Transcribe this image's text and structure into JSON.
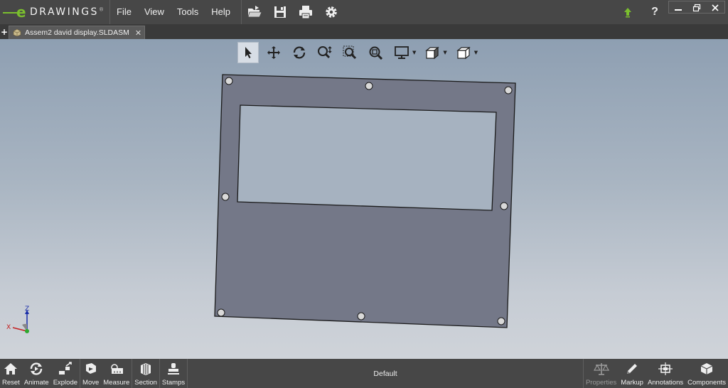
{
  "app": {
    "logo_letter": "e",
    "logo_text": "DRAWINGS",
    "logo_reg": "®"
  },
  "menu": {
    "items": [
      "File",
      "View",
      "Tools",
      "Help"
    ]
  },
  "quick_access": {
    "icons": [
      "open-folder-icon",
      "save-icon",
      "print-icon",
      "gear-icon"
    ]
  },
  "title_right": {
    "update_icon": "green-up-arrow-icon",
    "help_label": "?",
    "window_controls": [
      "minimize",
      "restore",
      "close"
    ]
  },
  "tab": {
    "plus": "+",
    "label": "Assem2 david display.SLDASM",
    "close": "✕"
  },
  "view_toolbar": {
    "tools": [
      "select-arrow-icon",
      "pan-icon",
      "rotate-icon",
      "zoom-in-out-icon",
      "zoom-to-area-icon",
      "zoom-to-fit-icon",
      "display-style-icon",
      "view-orientation-icon",
      "standard-views-icon"
    ]
  },
  "triad": {
    "z": "Z",
    "x": "X"
  },
  "bottom": {
    "left_groups": [
      [
        {
          "label": "Reset",
          "icon": "home-icon"
        },
        {
          "label": "Animate",
          "icon": "animate-icon"
        },
        {
          "label": "Explode",
          "icon": "explode-icon"
        }
      ],
      [
        {
          "label": "Move",
          "icon": "move-icon"
        },
        {
          "label": "Measure",
          "icon": "measure-icon"
        }
      ],
      [
        {
          "label": "Section",
          "icon": "section-icon"
        }
      ],
      [
        {
          "label": "Stamps",
          "icon": "stamp-icon"
        }
      ]
    ],
    "center_label": "Default",
    "right_items": [
      {
        "label": "Properties",
        "icon": "scale-icon",
        "disabled": true
      },
      {
        "label": "Markup",
        "icon": "pencil-icon",
        "disabled": false
      },
      {
        "label": "Annotations",
        "icon": "annotations-icon",
        "disabled": false
      },
      {
        "label": "Components",
        "icon": "components-icon",
        "disabled": false
      }
    ]
  },
  "colors": {
    "title_bg": "#474747",
    "accent_green": "#7bbf2e",
    "plate": "#747888",
    "window": "#a6b2c0"
  }
}
